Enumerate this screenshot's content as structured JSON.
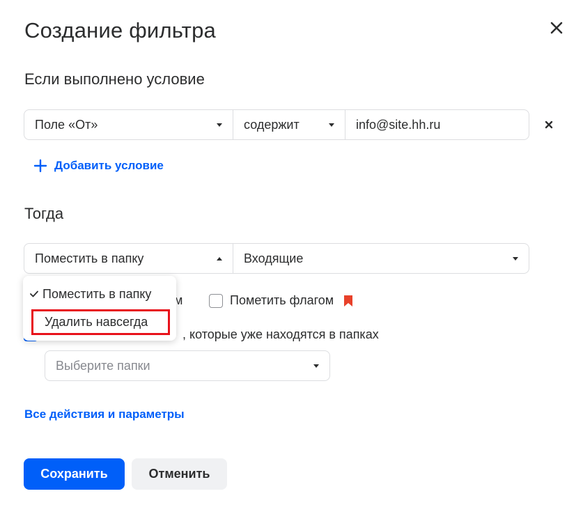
{
  "dialog": {
    "title": "Создание фильтра"
  },
  "condition_section": {
    "title": "Если выполнено условие",
    "field": "Поле «От»",
    "operator": "содержит",
    "value": "info@site.hh.ru",
    "add_label": "Добавить условие"
  },
  "action_section": {
    "title": "Тогда",
    "action": "Поместить в папку",
    "folder": "Входящие",
    "hidden_option_fragment": "м",
    "flag_label": "Пометить флагом",
    "apply_text": ", которые уже находятся в папках",
    "folders_placeholder": "Выберите папки"
  },
  "dropdown": {
    "selected_option": "Поместить в папку",
    "delete_option": "Удалить навсегда"
  },
  "links": {
    "all_actions": "Все действия и параметры"
  },
  "buttons": {
    "save": "Сохранить",
    "cancel": "Отменить"
  },
  "colors": {
    "accent": "#005ff9",
    "flag": "#e8412a",
    "highlight": "#e8121b"
  },
  "icons": [
    "close-icon",
    "remove-icon",
    "plus-icon",
    "dropdown-arrow-icon",
    "flag-icon",
    "check-icon"
  ]
}
